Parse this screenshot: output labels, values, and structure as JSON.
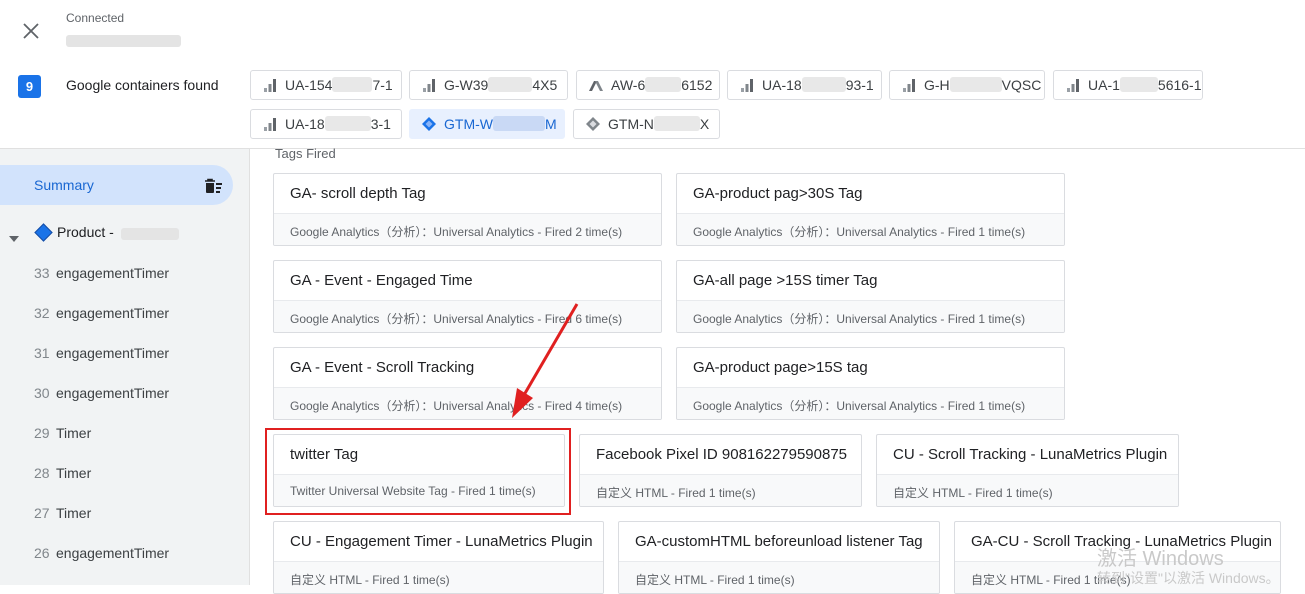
{
  "header": {
    "close_label": "close",
    "status": "Connected"
  },
  "containers": {
    "count": "9",
    "found_label": "Google containers found",
    "chips": [
      {
        "pre": "UA-154",
        "post": "7-1",
        "icon": "analytics-bars-icon"
      },
      {
        "pre": "G-W39",
        "post": "4X5",
        "icon": "analytics-bars-icon"
      },
      {
        "pre": "AW-6",
        "post": "6152",
        "icon": "google-ads-icon"
      },
      {
        "pre": "UA-18",
        "post": "93-1",
        "icon": "analytics-bars-icon"
      },
      {
        "pre": "G-H",
        "post": "VQSC",
        "icon": "analytics-bars-icon"
      },
      {
        "pre": "UA-1",
        "post": "5616-1",
        "icon": "analytics-bars-icon"
      },
      {
        "pre": "UA-18",
        "post": "3-1",
        "icon": "analytics-bars-icon"
      },
      {
        "pre": "GTM-W",
        "post": "M",
        "icon": "gtm-diamond-icon",
        "active": true
      },
      {
        "pre": "GTM-N",
        "post": "X",
        "icon": "gtm-diamond-icon"
      }
    ]
  },
  "sidebar": {
    "summary_label": "Summary",
    "product_label": "Product -",
    "events": [
      {
        "num": "33",
        "name": "engagementTimer"
      },
      {
        "num": "32",
        "name": "engagementTimer"
      },
      {
        "num": "31",
        "name": "engagementTimer"
      },
      {
        "num": "30",
        "name": "engagementTimer"
      },
      {
        "num": "29",
        "name": "Timer"
      },
      {
        "num": "28",
        "name": "Timer"
      },
      {
        "num": "27",
        "name": "Timer"
      },
      {
        "num": "26",
        "name": "engagementTimer"
      }
    ]
  },
  "main": {
    "section_title": "Tags Fired",
    "tags": [
      {
        "title": "GA- scroll depth Tag",
        "detail": "Google Analytics（分析）：Universal Analytics - Fired 2 time(s)"
      },
      {
        "title": "GA-product pag>30S Tag",
        "detail": "Google Analytics（分析）：Universal Analytics - Fired 1 time(s)"
      },
      {
        "title": "GA - Event - Engaged Time",
        "detail": "Google Analytics（分析）：Universal Analytics - Fired 6 time(s)"
      },
      {
        "title": "GA-all page >15S timer Tag",
        "detail": "Google Analytics（分析）：Universal Analytics - Fired 1 time(s)"
      },
      {
        "title": "GA - Event - Scroll Tracking",
        "detail": "Google Analytics（分析）：Universal Analytics - Fired 4 time(s)"
      },
      {
        "title": "GA-product page>15S tag",
        "detail": "Google Analytics（分析）：Universal Analytics - Fired 1 time(s)"
      },
      {
        "title": "twitter Tag",
        "detail": "Twitter Universal Website Tag - Fired 1 time(s)"
      },
      {
        "title": "Facebook Pixel ID 908162279590875",
        "detail": "自定义 HTML - Fired 1 time(s)"
      },
      {
        "title": "CU - Scroll Tracking - LunaMetrics Plugin",
        "detail": "自定义 HTML - Fired 1 time(s)"
      },
      {
        "title": "CU - Engagement Timer - LunaMetrics Plugin",
        "detail": "自定义 HTML - Fired 1 time(s)"
      },
      {
        "title": "GA-customHTML beforeunload listener Tag",
        "detail": "自定义 HTML - Fired 1 time(s)"
      },
      {
        "title": "GA-CU - Scroll Tracking - LunaMetrics Plugin",
        "detail": "自定义 HTML - Fired 1 time(s)"
      }
    ]
  },
  "watermark": {
    "line1": "激活 Windows",
    "line2": "转到\"设置\"以激活 Windows。"
  },
  "colors": {
    "accent": "#1a73e8",
    "highlight": "#e02020",
    "sidebar_bg": "#f1f3f4",
    "summary_bg": "#d2e3fc"
  }
}
